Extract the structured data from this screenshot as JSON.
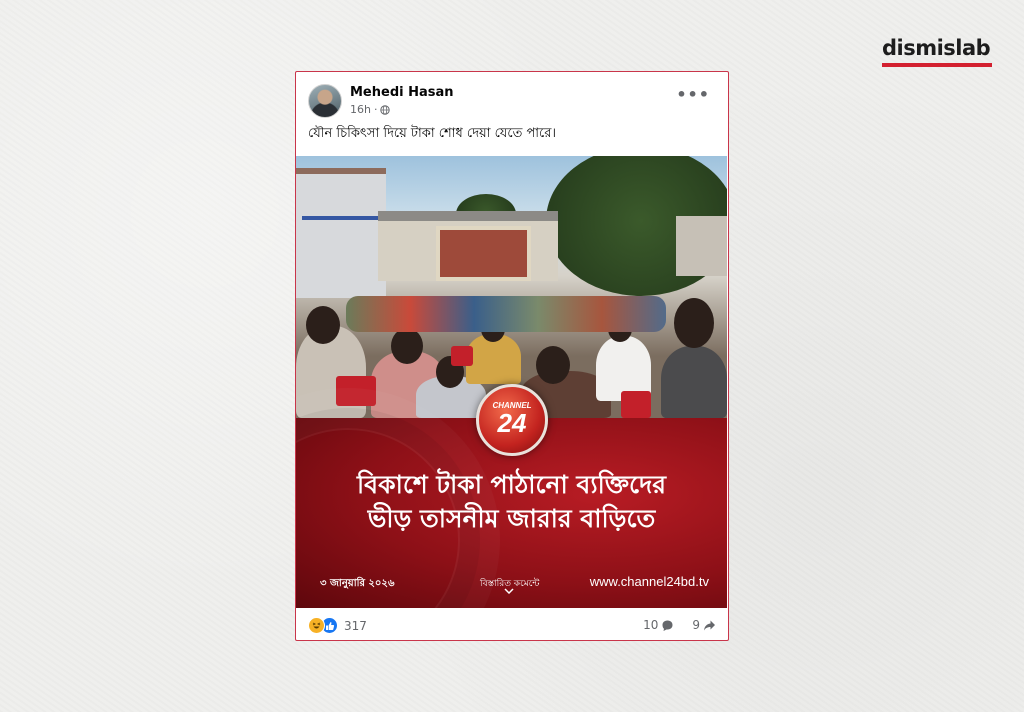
{
  "brand": {
    "logo_text": "dismislab",
    "accent": "#d3202f"
  },
  "post": {
    "author": "Mehedi Hasan",
    "time": "16h",
    "privacy_icon": "globe-icon",
    "caption": "যৌন চিকিৎসা দিয়ে টাকা শোধ দেয়া যেতে পারে।",
    "more_icon": "more-options-icon"
  },
  "media": {
    "channel_word": "CHANNEL",
    "channel_number": "24",
    "headline_line1": "বিকাশে টাকা পাঠানো ব্যক্তিদের",
    "headline_line2": "ভীড় তাসনীম জারার বাড়িতে",
    "date": "৩ জানুয়ারি ২০২৬",
    "details_label": "বিস্তারিত কমেন্টে",
    "website": "www.channel24bd.tv"
  },
  "footer": {
    "reactions": [
      "haha-icon",
      "like-icon"
    ],
    "reaction_count": "317",
    "comment_count": "10",
    "share_count": "9"
  },
  "colors": {
    "card_border": "#c9354a",
    "banner": "#8d1017"
  }
}
